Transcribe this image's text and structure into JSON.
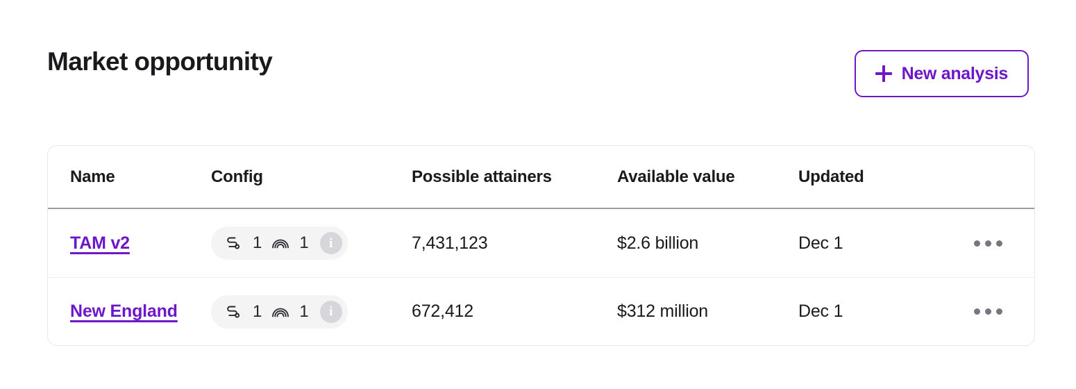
{
  "header": {
    "title": "Market opportunity",
    "new_analysis_label": "New analysis",
    "plus_icon": "plus-icon",
    "accent_color": "#6d17c9"
  },
  "table": {
    "columns": [
      {
        "key": "name",
        "label": "Name"
      },
      {
        "key": "config",
        "label": "Config"
      },
      {
        "key": "attainers",
        "label": "Possible attainers"
      },
      {
        "key": "value",
        "label": "Available value"
      },
      {
        "key": "updated",
        "label": "Updated"
      }
    ],
    "rows": [
      {
        "name": "TAM v2",
        "config": {
          "route_icon": "route-path-icon",
          "route_count": "1",
          "rainbow_icon": "rainbow-icon",
          "rainbow_count": "1",
          "info_icon": "info-circle-icon",
          "info_glyph": "i"
        },
        "attainers": "7,431,123",
        "value": "$2.6 billion",
        "updated": "Dec 1",
        "actions_icon": "ellipsis-icon"
      },
      {
        "name": "New England",
        "config": {
          "route_icon": "route-path-icon",
          "route_count": "1",
          "rainbow_icon": "rainbow-icon",
          "rainbow_count": "1",
          "info_icon": "info-circle-icon",
          "info_glyph": "i"
        },
        "attainers": "672,412",
        "value": "$312 million",
        "updated": "Dec 1",
        "actions_icon": "ellipsis-icon"
      }
    ]
  },
  "colors": {
    "link": "#6d17c9",
    "text": "#1a1a1e",
    "chip_bg": "#f4f4f5",
    "divider": "#9a9aa1",
    "row_divider": "#ececed",
    "card_border": "#e8e8ea"
  }
}
